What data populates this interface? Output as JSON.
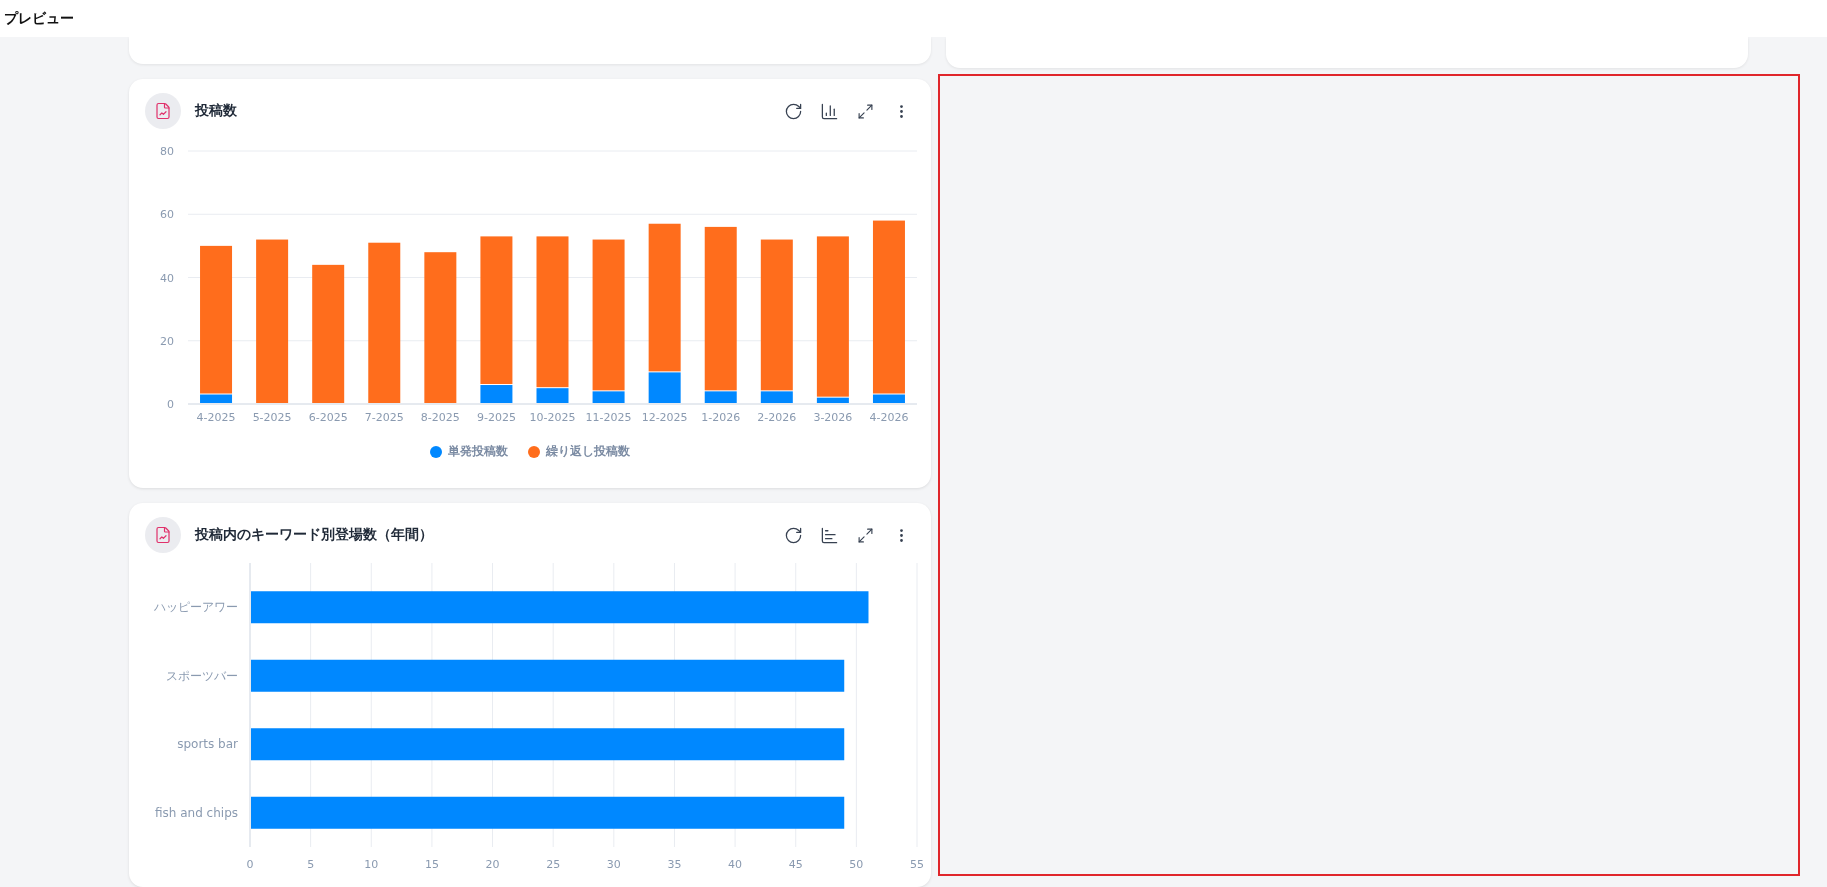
{
  "header": {
    "title": "プレビュー"
  },
  "cards": [
    {
      "title": "投稿数",
      "chart_data": {
        "type": "bar",
        "grid": true,
        "stacked": true,
        "orientation": "vertical",
        "categories": [
          "4-2025",
          "5-2025",
          "6-2025",
          "7-2025",
          "8-2025",
          "9-2025",
          "10-2025",
          "11-2025",
          "12-2025",
          "1-2026",
          "2-2026",
          "3-2026",
          "4-2026"
        ],
        "ylim": [
          0,
          80
        ],
        "yticks": [
          0,
          20,
          40,
          60,
          80
        ],
        "series": [
          {
            "name": "単発投稿数",
            "color": "#0088ff",
            "values": [
              3,
              0,
              0,
              0,
              0,
              6,
              5,
              4,
              10,
              4,
              4,
              2,
              3
            ]
          },
          {
            "name": "繰り返し投稿数",
            "color": "#ff6d1c",
            "values": [
              47,
              52,
              44,
              51,
              48,
              47,
              48,
              48,
              47,
              52,
              48,
              51,
              55
            ]
          }
        ]
      }
    },
    {
      "title": "投稿内のキーワード別登場数（年間）",
      "chart_data": {
        "type": "bar",
        "grid": true,
        "orientation": "horizontal",
        "categories": [
          "ハッピーアワー",
          "スポーツバー",
          "sports bar",
          "fish and chips"
        ],
        "xlim": [
          0,
          55
        ],
        "xticks": [
          0,
          5,
          10,
          15,
          20,
          25,
          30,
          35,
          40,
          45,
          50,
          55
        ],
        "series": [
          {
            "color": "#0088ff",
            "values": [
              51,
              49,
              49,
              49
            ]
          }
        ]
      }
    }
  ]
}
